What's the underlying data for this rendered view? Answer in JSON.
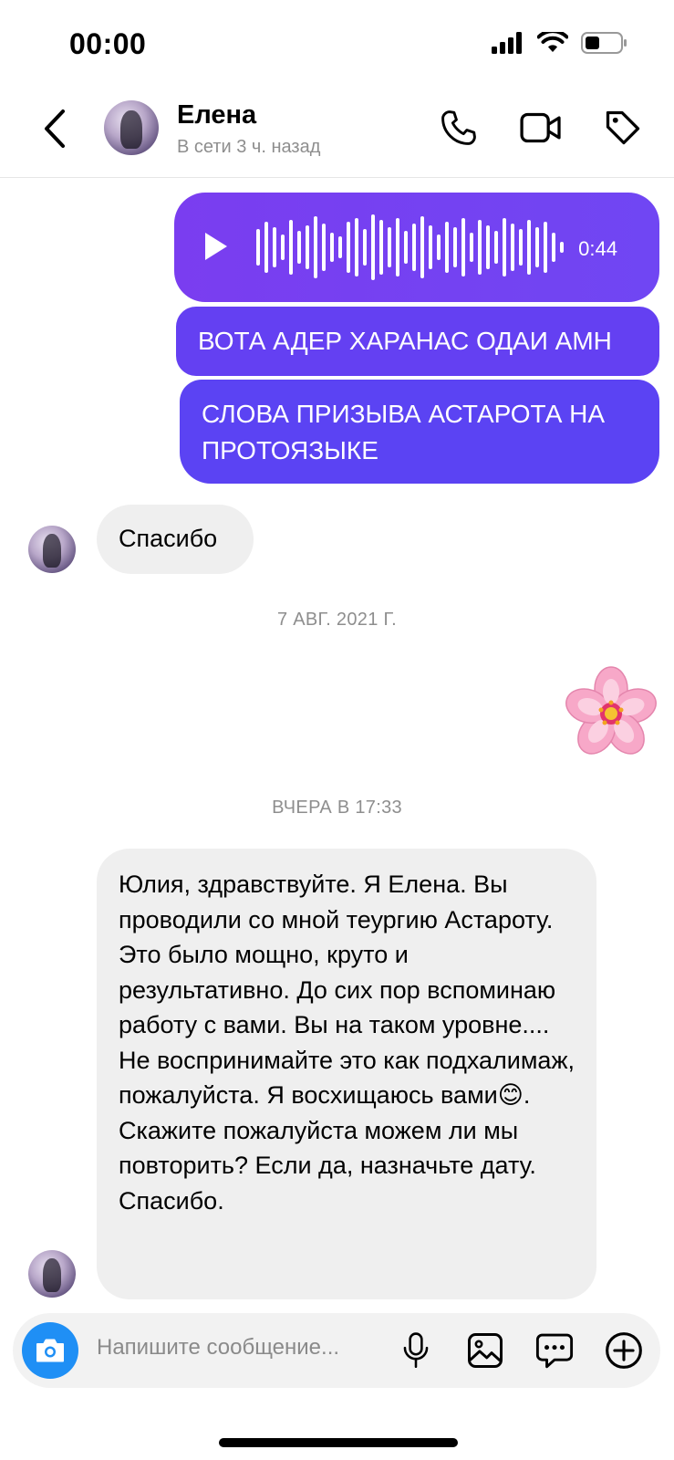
{
  "status_bar": {
    "time": "00:00"
  },
  "header": {
    "contact_name": "Елена",
    "contact_status": "В сети 3 ч. назад",
    "icons": [
      "back-chevron-icon",
      "phone-icon",
      "video-camera-icon",
      "tag-icon"
    ]
  },
  "messages": {
    "voice": {
      "duration": "0:44"
    },
    "outgoing_1": "ВОТА АДЕР ХАРАНАС ОДАИ АМН",
    "outgoing_2": "СЛОВА ПРИЗЫВА АСТАРОТА НА ПРОТОЯЗЫКЕ",
    "incoming_1": "Спасибо",
    "date_separator_1": "7 АВГ. 2021 Г.",
    "sticker": "🌸",
    "date_separator_2": "ВЧЕРА В 17:33",
    "incoming_2": "Юлия, здравствуйте. Я Елена. Вы проводили со мной теургию Астароту.  Это было мощно, круто и результативно.  До сих пор вспоминаю работу с вами.  Вы на таком уровне.... Не воспринимайте это как подхалимаж, пожалуйста.  Я восхищаюсь вами😊.   Скажите пожалуйста можем ли мы повторить? Если да, назначьте дату.  Спасибо."
  },
  "composer": {
    "placeholder": "Напишите сообщение...",
    "icons": [
      "camera-icon",
      "microphone-icon",
      "gallery-icon",
      "sticker-chat-icon",
      "add-icon"
    ]
  },
  "colors": {
    "outgoing_bubble": "#6a3df1",
    "incoming_bubble": "#efefef",
    "camera_button": "#1f8ff5",
    "secondary_text": "#8e8e8e"
  }
}
